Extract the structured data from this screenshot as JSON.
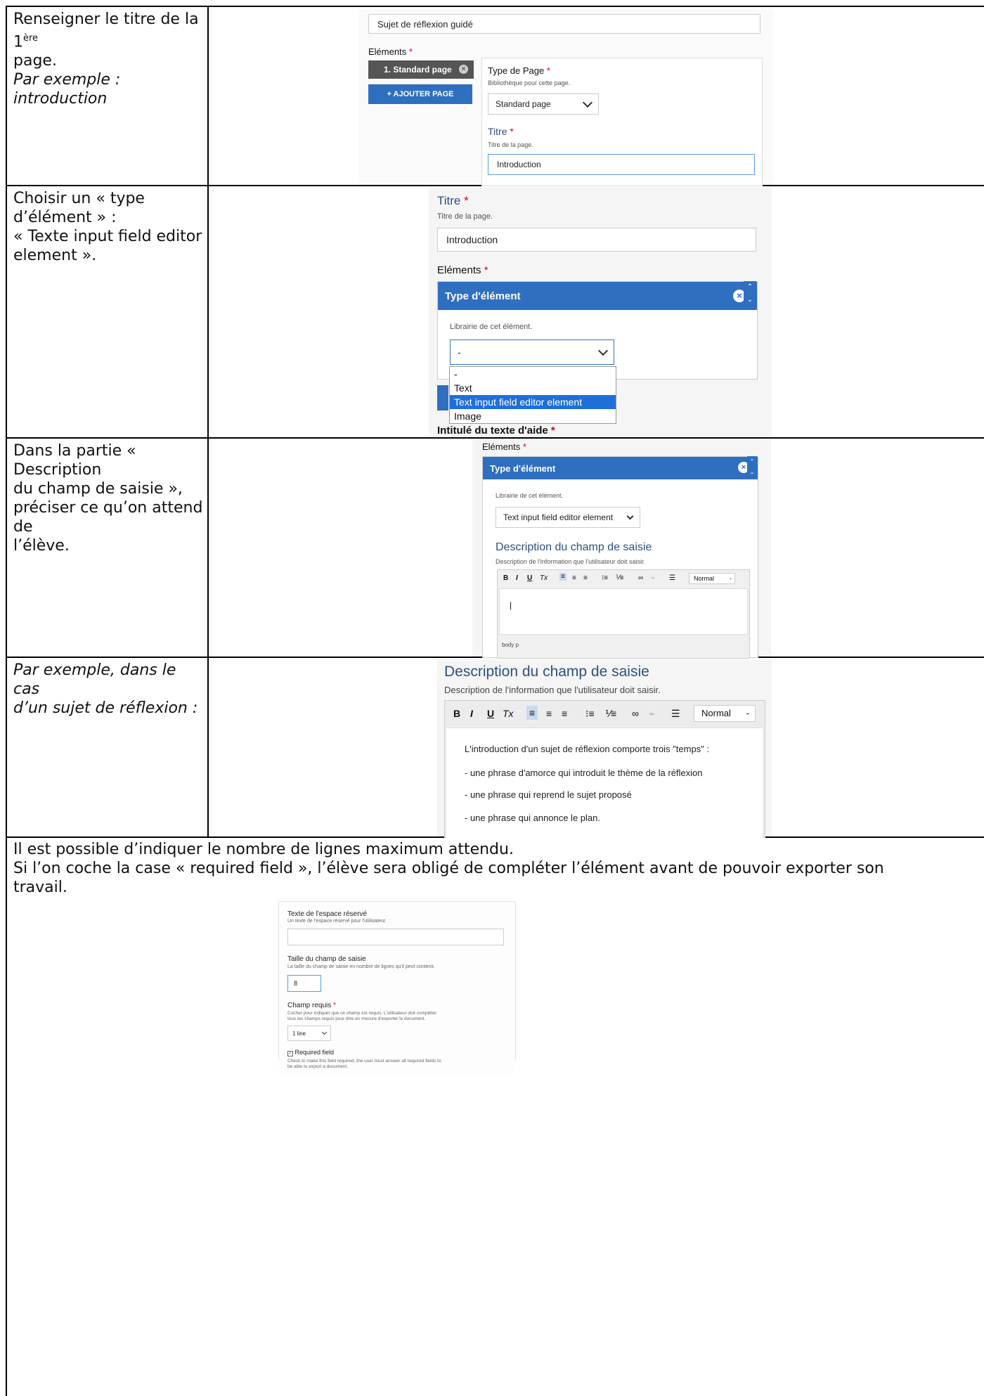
{
  "rows": {
    "r1": {
      "text_prefix": "Renseigner le titre de la 1",
      "text_sup": "ère",
      "text_line2": "page.",
      "text_italic": "Par exemple : introduction",
      "shot": {
        "title_input": "Sujet de réflexion guidé",
        "elements_label": "Eléments",
        "page_item": "1. Standard page",
        "add_page_button": "+ AJOUTER PAGE",
        "type_page_label": "Type de Page",
        "type_page_help": "Bibliothèque pour cette page.",
        "type_page_value": "Standard page",
        "titre_label": "Titre",
        "titre_help": "Titre de la page.",
        "titre_value": "Introduction"
      }
    },
    "r2": {
      "lines": [
        "Choisir un « type",
        "d’élément » :",
        "« Texte input field editor",
        "element »."
      ],
      "shot": {
        "titre_label": "Titre",
        "titre_help": "Titre de la page.",
        "titre_value": "Introduction",
        "elements_label": "Eléments",
        "type_element_header": "Type d'élément",
        "lib_help": "Librairie de cet élément.",
        "select_value": "-",
        "options": [
          "-",
          "Text",
          "Text input field editor element",
          "Image"
        ],
        "selected_option_index": 2,
        "next_label": "Intitulé du texte d'aide"
      }
    },
    "r3": {
      "lines": [
        "Dans la partie « Description",
        "du champ de saisie »,",
        "préciser ce qu’on attend de",
        "l’élève."
      ],
      "shot": {
        "elements_label": "Eléments",
        "type_element_header": "Type d'élément",
        "lib_help": "Librairie de cet élément.",
        "select_value": "Text input field editor element",
        "desc_title": "Description du champ de saisie",
        "desc_help": "Description de l'information que l'utilisateur doit saisir.",
        "format_value": "Normal",
        "editor_caret": "|",
        "status_path": "body   p"
      }
    },
    "r4": {
      "lines": [
        "Par exemple, dans le cas",
        "d’un sujet de réflexion :"
      ],
      "shot": {
        "desc_title": "Description du champ de saisie",
        "desc_help": "Description de l'information que l'utilisateur doit saisir.",
        "format_value": "Normal",
        "editor_lines": [
          "L'introduction d'un sujet de réflexion comporte trois \"temps\" :",
          "- une phrase d'amorce qui introduit le thème de la réflexion",
          "- une phrase qui reprend le sujet proposé",
          "- une phrase qui annonce le plan."
        ]
      }
    },
    "r5": {
      "lines": [
        "Il est possible d’indiquer le nombre de lignes maximum attendu.",
        "Si l’on coche la case « required field », l’élève sera obligé de compléter l’élément avant de pouvoir exporter son",
        "travail."
      ],
      "shot": {
        "placeholder_label": "Texte de l'espace réservé",
        "placeholder_help": "Un texte de l'espace réservé pour l'utilisateur.",
        "size_label": "Taille du champ de saisie",
        "size_help": "La taille du champ de saisie en nombre de lignes qu'il peut contenir.",
        "size_value": "8",
        "required_label": "Champ requis",
        "required_help_1": "Cocher pour indiquer que ce champ est requis. L'utilisateur doit compléter",
        "required_help_2": "tous les champs requis pour être en mesure d'exporter le document.",
        "line_select": "1 line",
        "checkbox_label": "Required field",
        "checkbox_help_1": "Check to make this field required, the user must answer all required fields to",
        "checkbox_help_2": "be able to export a document."
      }
    }
  },
  "toolbar": {
    "bold": "B",
    "italic": "I",
    "underline": "U",
    "clear": "Tx",
    "align_left": "≡",
    "align_center": "≡",
    "align_right": "≡",
    "ul": "⁝≡",
    "ol": "⅟≡",
    "link": "∞",
    "unlink": "⌁",
    "hr": "☰"
  },
  "colors": {
    "accent_blue": "#2f6fbf",
    "required_red": "#d0021b",
    "dark_tab": "#555555",
    "selected_option": "#1e6fd9"
  }
}
